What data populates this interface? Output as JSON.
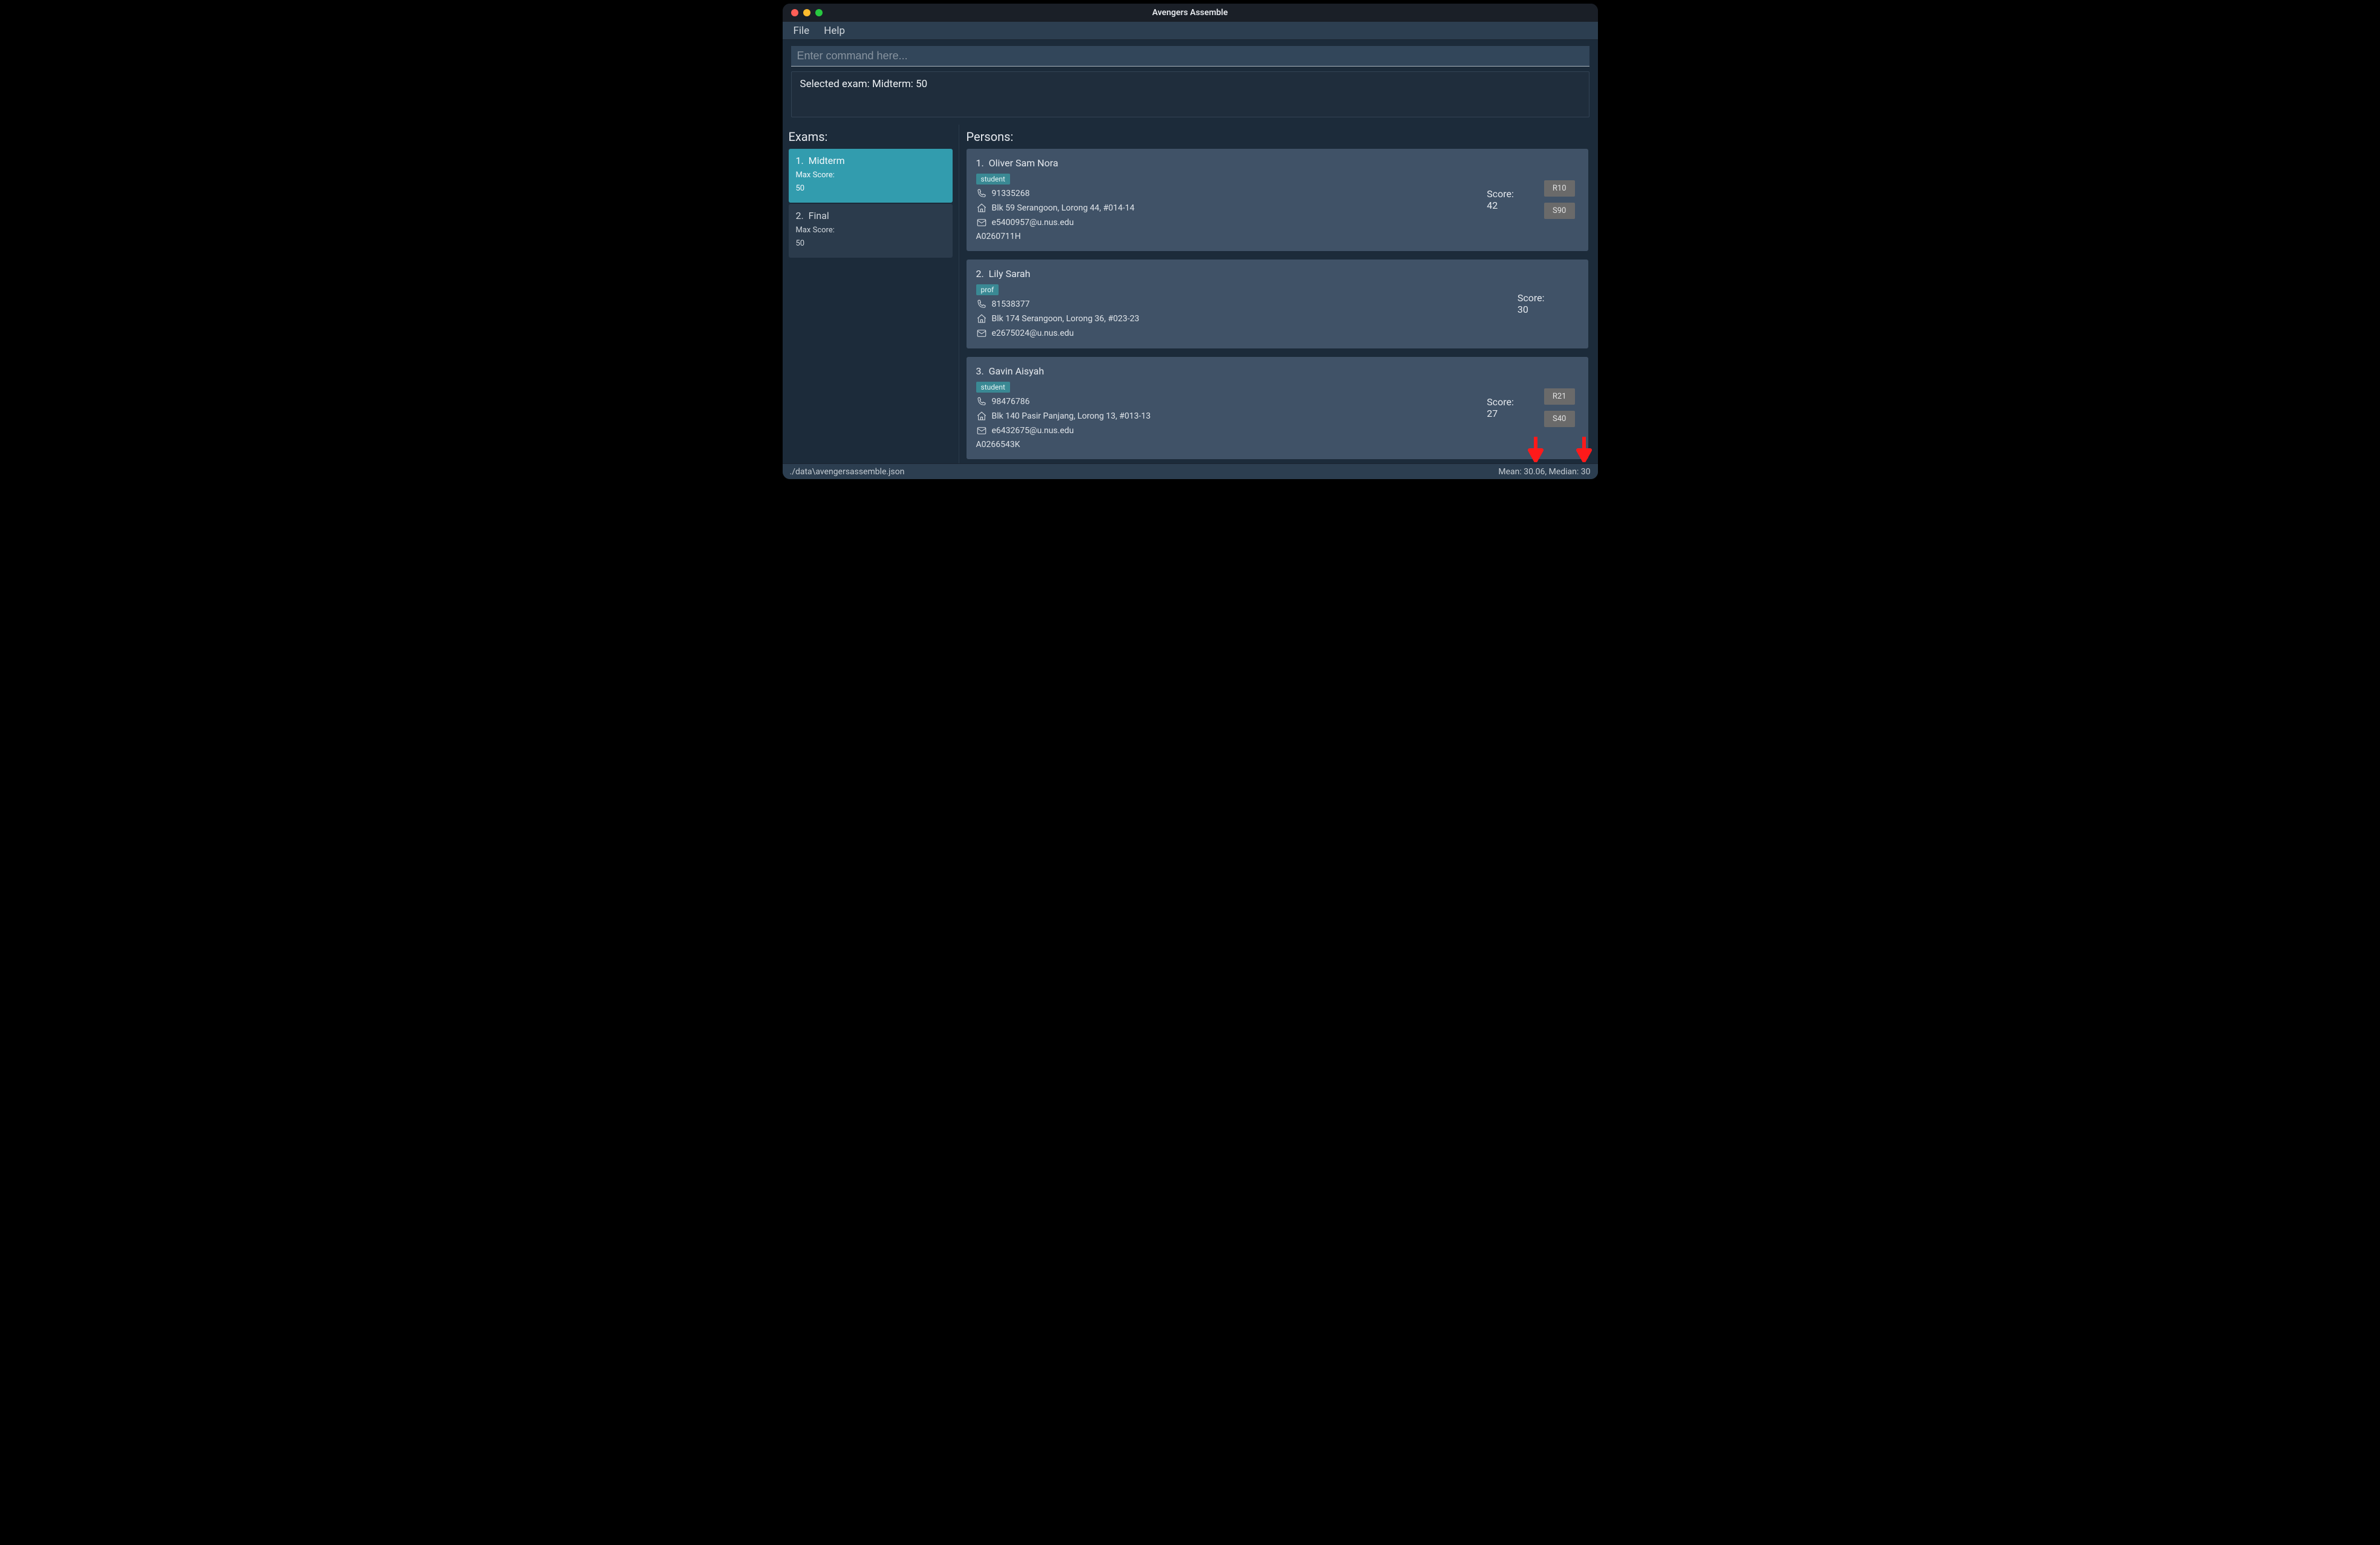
{
  "window": {
    "title": "Avengers Assemble"
  },
  "menu": {
    "file": "File",
    "help": "Help"
  },
  "command": {
    "placeholder": "Enter command here..."
  },
  "status": {
    "text": "Selected exam: Midterm: 50"
  },
  "sidebar": {
    "header": "Exams:",
    "exams": [
      {
        "index": "1.",
        "name": "Midterm",
        "max_label": "Max Score:",
        "max_value": "50",
        "selected": true
      },
      {
        "index": "2.",
        "name": "Final",
        "max_label": "Max Score:",
        "max_value": "50",
        "selected": false
      }
    ]
  },
  "main": {
    "header": "Persons:",
    "persons": [
      {
        "index": "1.",
        "name": "Oliver Sam Nora",
        "tag": "student",
        "phone": "91335268",
        "address": "Blk 59 Serangoon, Lorong 44, #014-14",
        "email": "e5400957@u.nus.edu",
        "matric": "A0260711H",
        "score_label": "Score:",
        "score_value": "42",
        "side_tags": [
          "R10",
          "S90"
        ]
      },
      {
        "index": "2.",
        "name": "Lily Sarah",
        "tag": "prof",
        "phone": "81538377",
        "address": "Blk 174 Serangoon, Lorong 36, #023-23",
        "email": "e2675024@u.nus.edu",
        "matric": "",
        "score_label": "Score:",
        "score_value": "30",
        "side_tags": []
      },
      {
        "index": "3.",
        "name": "Gavin Aisyah",
        "tag": "student",
        "phone": "98476786",
        "address": "Blk 140 Pasir Panjang, Lorong 13, #013-13",
        "email": "e6432675@u.nus.edu",
        "matric": "A0266543K",
        "score_label": "Score:",
        "score_value": "27",
        "side_tags": [
          "R21",
          "S40"
        ]
      }
    ]
  },
  "footer": {
    "path": "./data\\avengersassemble.json",
    "stats": "Mean: 30.06, Median: 30"
  }
}
